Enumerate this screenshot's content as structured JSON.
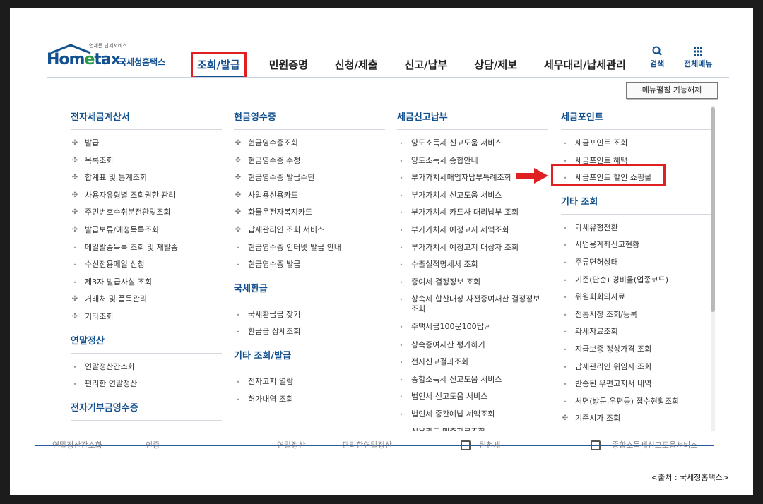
{
  "logo": {
    "tagline": "언제든 납세서비스",
    "word_a": "Hom",
    "word_e": "e",
    "word_b": "tax.",
    "sub": "국세청홈택스"
  },
  "nav": [
    {
      "label": "조회/발급",
      "active": true
    },
    {
      "label": "민원증명",
      "active": false
    },
    {
      "label": "신청/제출",
      "active": false
    },
    {
      "label": "신고/납부",
      "active": false
    },
    {
      "label": "상담/제보",
      "active": false
    },
    {
      "label": "세무대리/납세관리",
      "active": false
    }
  ],
  "tools": {
    "search": "검색",
    "all_menu": "전체메뉴"
  },
  "unfold_button": "메뉴펼침 기능해제",
  "columns": [
    {
      "sections": [
        {
          "title": "전자세금계산서",
          "items": [
            {
              "label": "발급",
              "type": "plus"
            },
            {
              "label": "목록조회",
              "type": "plus"
            },
            {
              "label": "합계표 및 통계조회",
              "type": "plus"
            },
            {
              "label": "사용자유형별 조회권한 관리",
              "type": "plus"
            },
            {
              "label": "주민번호수취분전환및조회",
              "type": "plus"
            },
            {
              "label": "발급보류/예정목록조회",
              "type": "plus"
            },
            {
              "label": "메일발송목록 조회 및 재발송",
              "type": "dot"
            },
            {
              "label": "수신전용메일 신청",
              "type": "dot"
            },
            {
              "label": "제3자 발급사실 조회",
              "type": "dot"
            },
            {
              "label": "거래처 및 품목관리",
              "type": "plus"
            },
            {
              "label": "기타조회",
              "type": "plus"
            }
          ]
        },
        {
          "title": "연말정산",
          "items": [
            {
              "label": "연말정산간소화",
              "type": "dot"
            },
            {
              "label": "편리한 연말정산",
              "type": "dot"
            }
          ]
        },
        {
          "title": "전자기부금영수증",
          "items": []
        }
      ]
    },
    {
      "sections": [
        {
          "title": "현금영수증",
          "items": [
            {
              "label": "현금영수증조회",
              "type": "plus"
            },
            {
              "label": "현금영수증 수정",
              "type": "plus"
            },
            {
              "label": "현금영수증 발급수단",
              "type": "plus"
            },
            {
              "label": "사업용신용카드",
              "type": "plus"
            },
            {
              "label": "화물운전자복지카드",
              "type": "plus"
            },
            {
              "label": "납세관리인 조회 서비스",
              "type": "plus"
            },
            {
              "label": "현금영수증 인터넷 발급 안내",
              "type": "dot"
            },
            {
              "label": "현금영수증 발급",
              "type": "dot"
            }
          ]
        },
        {
          "title": "국세환급",
          "items": [
            {
              "label": "국세환급금 찾기",
              "type": "dot"
            },
            {
              "label": "환급금 상세조회",
              "type": "dot"
            }
          ]
        },
        {
          "title": "기타 조회/발급",
          "items": [
            {
              "label": "전자고지 열람",
              "type": "dot"
            },
            {
              "label": "허가내역 조회",
              "type": "dot"
            }
          ]
        },
        {
          "title": "",
          "items": []
        }
      ]
    },
    {
      "sections": [
        {
          "title": "세금신고납부",
          "items": [
            {
              "label": "양도소득세 신고도움 서비스",
              "type": "dot"
            },
            {
              "label": "양도소득세 종합안내",
              "type": "dot"
            },
            {
              "label": "부가가치세매입자납부특례조회",
              "type": "dot"
            },
            {
              "label": "부가가치세 신고도움 서비스",
              "type": "dot"
            },
            {
              "label": "부가가치세 카드사 대리납부 조회",
              "type": "dot"
            },
            {
              "label": "부가가치세 예정고지 세액조회",
              "type": "dot"
            },
            {
              "label": "부가가치세 예정고지 대상자 조회",
              "type": "dot"
            },
            {
              "label": "수출실적명세서 조회",
              "type": "dot"
            },
            {
              "label": "증여세 결정정보 조회",
              "type": "dot"
            },
            {
              "label": "상속세 합산대상 사전증여재산 결정정보 조회",
              "type": "dot",
              "wrap": true
            },
            {
              "label": "주택세금100문100답",
              "type": "dot",
              "ext": "⇗"
            },
            {
              "label": "상속증여재산 평가하기",
              "type": "dot"
            },
            {
              "label": "전자신고결과조회",
              "type": "dot"
            },
            {
              "label": "종합소득세 신고도움 서비스",
              "type": "dot"
            },
            {
              "label": "법인세 신고도움 서비스",
              "type": "dot"
            },
            {
              "label": "법인세 중간예납 세액조회",
              "type": "dot"
            },
            {
              "label": "신용카드 매출자료조회",
              "type": "dot"
            }
          ]
        }
      ]
    },
    {
      "sections": [
        {
          "title": "세금포인트",
          "items": [
            {
              "label": "세금포인트 조회",
              "type": "dot"
            },
            {
              "label": "세금포인트 혜택",
              "type": "dot"
            },
            {
              "label": "세금포인트 할인 쇼핑몰",
              "type": "dot"
            }
          ]
        },
        {
          "title": "기타 조회",
          "items": [
            {
              "label": "과세유형전환",
              "type": "dot"
            },
            {
              "label": "사업용계좌신고현황",
              "type": "dot"
            },
            {
              "label": "주류면허상태",
              "type": "dot"
            },
            {
              "label": "기준(단순) 경비율(업종코드)",
              "type": "dot"
            },
            {
              "label": "위원회회의자료",
              "type": "dot"
            },
            {
              "label": "전통시장 조회/등록",
              "type": "dot"
            },
            {
              "label": "과세자료조회",
              "type": "dot"
            },
            {
              "label": "지급보증 정상가격 조회",
              "type": "dot"
            },
            {
              "label": "납세관리인 위임자 조회",
              "type": "dot"
            },
            {
              "label": "반송된 우편고지서 내역",
              "type": "dot"
            },
            {
              "label": "서면(방문,우편등) 접수현황조회",
              "type": "dot"
            },
            {
              "label": "기준시가 조회",
              "type": "plus"
            }
          ]
        }
      ]
    }
  ],
  "bottom_strip": {
    "texts": [
      "연말정산간소화",
      "인증",
      "연말정산",
      "편리한연말정산",
      "원천세",
      "종합소득세신고도움서비스"
    ]
  },
  "source": "<출처 : 국세청홈택스>",
  "colors": {
    "brand": "#12508f",
    "highlight": "#e02020"
  }
}
